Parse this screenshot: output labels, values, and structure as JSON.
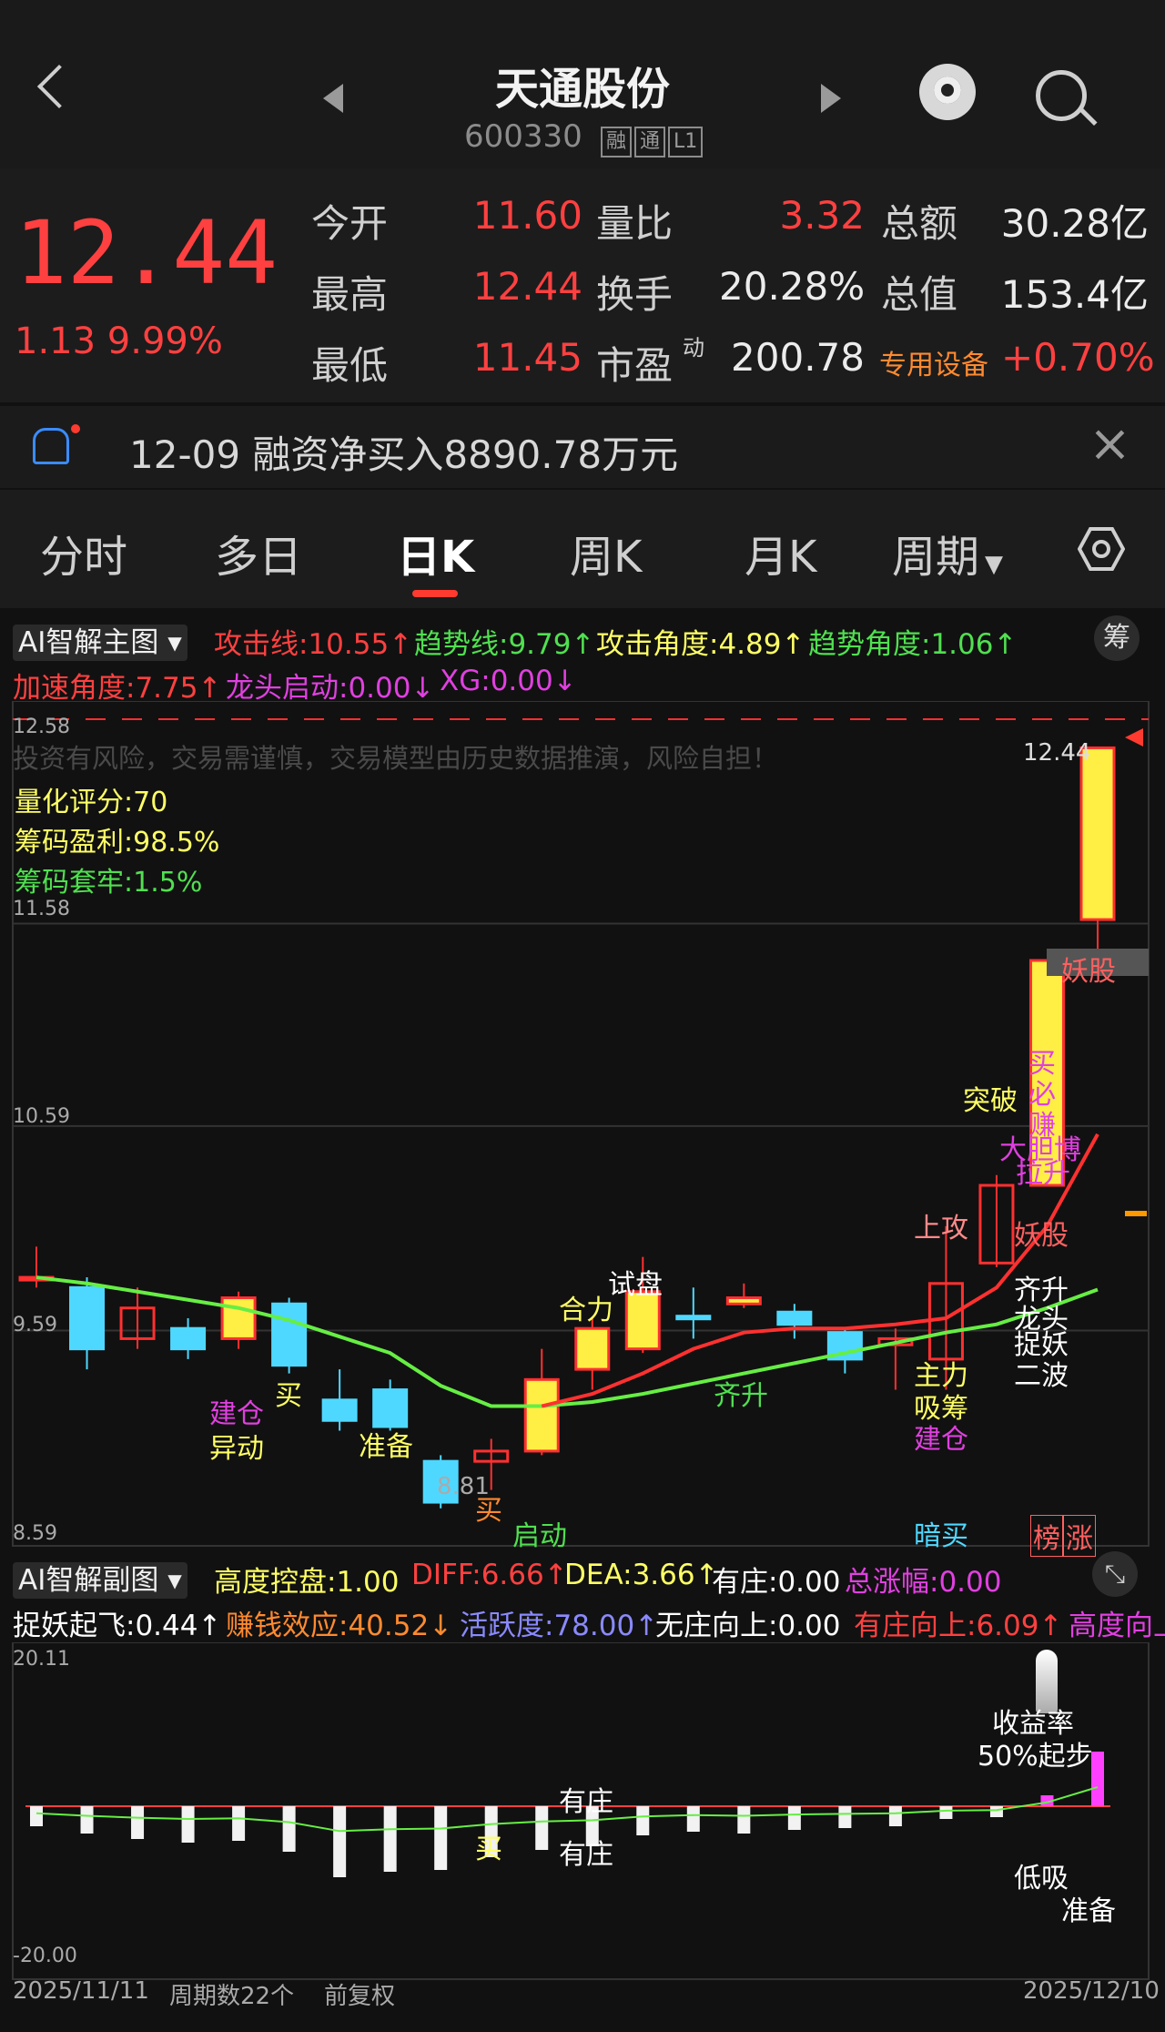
{
  "header": {
    "title": "天通股份",
    "code": "600330",
    "badges": [
      "融",
      "通",
      "L1"
    ]
  },
  "quote": {
    "price": "12.44",
    "change": "1.13",
    "change_pct": "9.99%",
    "rows": [
      {
        "l1": "今开",
        "v1": "11.60",
        "l2": "量比",
        "v2": "3.32",
        "l3": "总额",
        "v3": "30.28亿"
      },
      {
        "l1": "最高",
        "v1": "12.44",
        "l2": "换手",
        "v2": "20.28%",
        "l3": "总值",
        "v3": "153.4亿"
      },
      {
        "l1": "最低",
        "v1": "11.45",
        "l2": "市盈",
        "l2sup": "动",
        "v2": "200.78",
        "l3": "专用设备",
        "v3": "+0.70%"
      }
    ]
  },
  "notice": {
    "text": "12-09 融资净买入8890.78万元"
  },
  "tabs": [
    "分时",
    "多日",
    "日K",
    "周K",
    "月K",
    "周期"
  ],
  "main_chart": {
    "selector": "AI智解主图",
    "chip_label": "筹",
    "indicators_row1": [
      "攻击线:10.55↑",
      "趋势线:9.79↑",
      "攻击角度:4.89↑",
      "趋势角度:1.06↑"
    ],
    "indicators_row2": [
      "加速角度:7.75↑",
      "龙头启动:0.00↓",
      "XG:0.00↓"
    ],
    "price_ticks": [
      "12.58",
      "11.58",
      "10.59",
      "9.59",
      "8.59"
    ],
    "disclaimer": "投资有风险，交易需谨慎，交易模型由历史数据推演，风险自担！",
    "score": "量化评分:70",
    "profit": "筹码盈利:98.5%",
    "trapped": "筹码套牢:1.5%",
    "last_price": "12.44",
    "low_label": "8.81",
    "labels": {
      "jiancang": "建仓",
      "yidong": "异动",
      "mai": "买",
      "zhunbei": "准备",
      "mai2": "买",
      "shipan": "试盘",
      "heli": "合力",
      "qisheng": "齐升",
      "qidong": "启动",
      "shanggong": "上攻",
      "tupo": "突破",
      "zhuli": "主力",
      "xishou": "吸筹",
      "jiancang2": "建仓",
      "yaogu": "妖股",
      "yaogu2": "妖股",
      "mai_bi_zhuan": "买必赚",
      "dadan": "大胆博",
      "lasheng": "拉升",
      "qisheng2": "齐升",
      "longtou": "龙头",
      "zhuoyao": "捉妖",
      "erbo": "二波",
      "anmai": "暗买",
      "bang": "榜",
      "zhang": "涨"
    }
  },
  "sub_chart": {
    "selector": "AI智解副图",
    "indicators_row1": [
      "高度控盘:1.00",
      "DIFF:6.66↑",
      "DEA:3.66↑",
      "有庄:0.00",
      "总涨幅:0.00"
    ],
    "indicators_row2": [
      "捉妖起飞:0.44↑",
      "赚钱效应:40.52↓",
      "活跃度:78.00↑",
      "无庄向上:0.00",
      "有庄向上:6.09↑",
      "高度向上"
    ],
    "ticks": [
      "20.11",
      "-20.00"
    ],
    "labels": {
      "youzhuang": "有庄",
      "youzhuang2": "有庄",
      "mai": "买",
      "shouyi": "收益率",
      "qibu": "50%起步",
      "dixi": "低吸",
      "zhunbei": "准备"
    }
  },
  "footer": {
    "start": "2025/11/11",
    "period": "周期数22个",
    "adj": "前复权",
    "end": "2025/12/10"
  },
  "chart_data": {
    "type": "candlestick",
    "x_range": [
      "2025/11/11",
      "2025/12/10"
    ],
    "ylim": [
      8.59,
      12.58
    ],
    "candles": [
      {
        "o": 9.85,
        "c": 9.85,
        "h": 10.0,
        "l": 9.8,
        "up": true
      },
      {
        "o": 9.8,
        "c": 9.5,
        "h": 9.85,
        "l": 9.4,
        "up": false
      },
      {
        "o": 9.55,
        "c": 9.7,
        "h": 9.8,
        "l": 9.5,
        "up": true
      },
      {
        "o": 9.6,
        "c": 9.5,
        "h": 9.65,
        "l": 9.45,
        "up": false
      },
      {
        "o": 9.55,
        "c": 9.75,
        "h": 9.78,
        "l": 9.5,
        "up": true
      },
      {
        "o": 9.72,
        "c": 9.42,
        "h": 9.75,
        "l": 9.38,
        "up": false
      },
      {
        "o": 9.25,
        "c": 9.15,
        "h": 9.4,
        "l": 9.1,
        "up": false
      },
      {
        "o": 9.3,
        "c": 9.12,
        "h": 9.35,
        "l": 9.1,
        "up": false
      },
      {
        "o": 8.95,
        "c": 8.75,
        "h": 8.98,
        "l": 8.72,
        "up": false
      },
      {
        "o": 8.95,
        "c": 9.0,
        "h": 9.06,
        "l": 8.81,
        "up": true
      },
      {
        "o": 9.0,
        "c": 9.35,
        "h": 9.5,
        "l": 8.98,
        "up": true
      },
      {
        "o": 9.4,
        "c": 9.6,
        "h": 9.65,
        "l": 9.3,
        "up": true
      },
      {
        "o": 9.5,
        "c": 9.78,
        "h": 9.95,
        "l": 9.48,
        "up": true
      },
      {
        "o": 9.66,
        "c": 9.66,
        "h": 9.8,
        "l": 9.55,
        "up": false
      },
      {
        "o": 9.72,
        "c": 9.75,
        "h": 9.82,
        "l": 9.7,
        "up": true
      },
      {
        "o": 9.68,
        "c": 9.62,
        "h": 9.72,
        "l": 9.55,
        "up": false
      },
      {
        "o": 9.58,
        "c": 9.45,
        "h": 9.6,
        "l": 9.38,
        "up": false
      },
      {
        "o": 9.52,
        "c": 9.55,
        "h": 9.6,
        "l": 9.3,
        "up": true
      },
      {
        "o": 9.45,
        "c": 9.82,
        "h": 10.1,
        "l": 9.3,
        "up": true
      },
      {
        "o": 9.92,
        "c": 10.3,
        "h": 10.35,
        "l": 9.9,
        "up": true
      },
      {
        "o": 10.3,
        "c": 11.4,
        "h": 11.4,
        "l": 10.3,
        "up": true
      },
      {
        "o": 11.6,
        "c": 12.44,
        "h": 12.44,
        "l": 11.45,
        "up": true
      }
    ],
    "attack_line": [
      null,
      null,
      null,
      null,
      null,
      null,
      null,
      null,
      null,
      null,
      9.22,
      9.28,
      9.38,
      9.5,
      9.58,
      9.6,
      9.6,
      9.62,
      9.65,
      9.8,
      10.1,
      10.55
    ],
    "trend_line": [
      9.85,
      9.82,
      9.78,
      9.74,
      9.7,
      9.64,
      9.56,
      9.48,
      9.32,
      9.22,
      9.22,
      9.24,
      9.28,
      9.33,
      9.38,
      9.43,
      9.48,
      9.53,
      9.58,
      9.62,
      9.7,
      9.79
    ]
  }
}
